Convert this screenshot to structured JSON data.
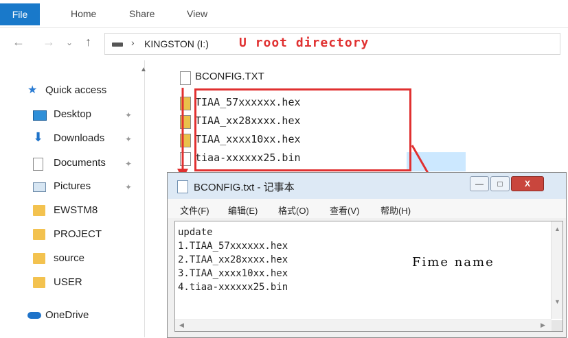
{
  "ribbon": {
    "tabs": [
      "File",
      "Home",
      "Share",
      "View"
    ]
  },
  "address": {
    "location": "KINGSTON (I:)",
    "annotation": "U root directory"
  },
  "nav": {
    "items": [
      {
        "label": "Quick access"
      },
      {
        "label": "Desktop"
      },
      {
        "label": "Downloads"
      },
      {
        "label": "Documents"
      },
      {
        "label": "Pictures"
      },
      {
        "label": "EWSTM8"
      },
      {
        "label": "PROJECT"
      },
      {
        "label": "source"
      },
      {
        "label": "USER"
      },
      {
        "label": "OneDrive"
      }
    ]
  },
  "files": [
    {
      "name": "BCONFIG.TXT",
      "icon": "text-file-icon"
    },
    {
      "name": "TIAA_57xxxxxx.hex",
      "icon": "hex-file-icon"
    },
    {
      "name": "TIAA_xx28xxxx.hex",
      "icon": "hex-file-icon"
    },
    {
      "name": "TIAA_xxxx10xx.hex",
      "icon": "hex-file-icon"
    },
    {
      "name": "tiaa-xxxxxx25.bin",
      "icon": "bin-file-icon"
    }
  ],
  "notepad": {
    "title": "BCONFIG.txt - 记事本",
    "menu": [
      "文件(F)",
      "编辑(E)",
      "格式(O)",
      "查看(V)",
      "帮助(H)"
    ],
    "lines": [
      "update",
      "1.TIAA_57xxxxxx.hex",
      "2.TIAA_xx28xxxx.hex",
      "3.TIAA_xxxx10xx.hex",
      "4.tiaa-xxxxxx25.bin"
    ]
  },
  "annotation": {
    "filename_label": "Fime name"
  },
  "colors": {
    "accent": "#1979ca",
    "annotation_red": "#e03030",
    "selection": "#cce8ff"
  }
}
